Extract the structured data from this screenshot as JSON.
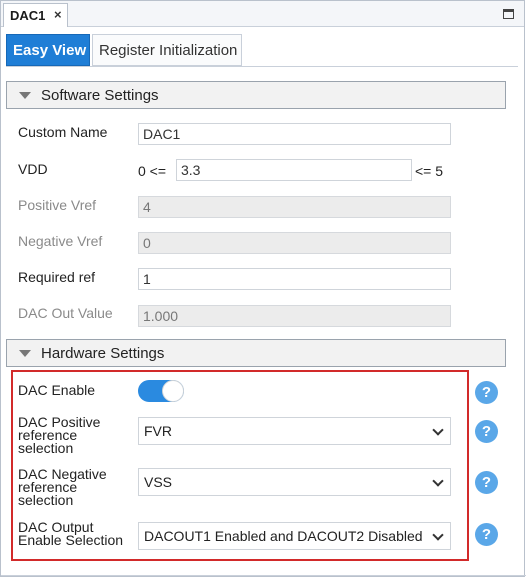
{
  "document_tab": {
    "title": "DAC1",
    "close_glyph": "×"
  },
  "view_tabs": [
    {
      "label": "Easy View",
      "active": true
    },
    {
      "label": "Register Initialization",
      "active": false
    }
  ],
  "software_settings": {
    "title": "Software Settings",
    "custom_name": {
      "label": "Custom Name",
      "value": "DAC1"
    },
    "vdd": {
      "label": "VDD",
      "prefix": "0 <=",
      "value": "3.3",
      "suffix": "<= 5"
    },
    "positive_vref": {
      "label": "Positive Vref",
      "value": "4"
    },
    "negative_vref": {
      "label": "Negative Vref",
      "value": "0"
    },
    "required_ref": {
      "label": "Required ref",
      "value": "1"
    },
    "dac_out_value": {
      "label": "DAC Out Value",
      "value": "1.000"
    }
  },
  "hardware_settings": {
    "title": "Hardware Settings",
    "dac_enable": {
      "label": "DAC Enable",
      "on": true
    },
    "dac_positive_ref": {
      "label": "DAC Positive reference selection",
      "value": "FVR"
    },
    "dac_negative_ref": {
      "label": "DAC Negative reference selection",
      "value": "VSS"
    },
    "dac_output_enable": {
      "label": "DAC Output Enable Selection",
      "value": "DACOUT1 Enabled and DACOUT2 Disabled"
    },
    "help_glyph": "?"
  },
  "colors": {
    "accent": "#1f7ed6",
    "toggle_on": "#2a8ae0",
    "help": "#5aa7e8",
    "highlight": "#d22a2a"
  }
}
